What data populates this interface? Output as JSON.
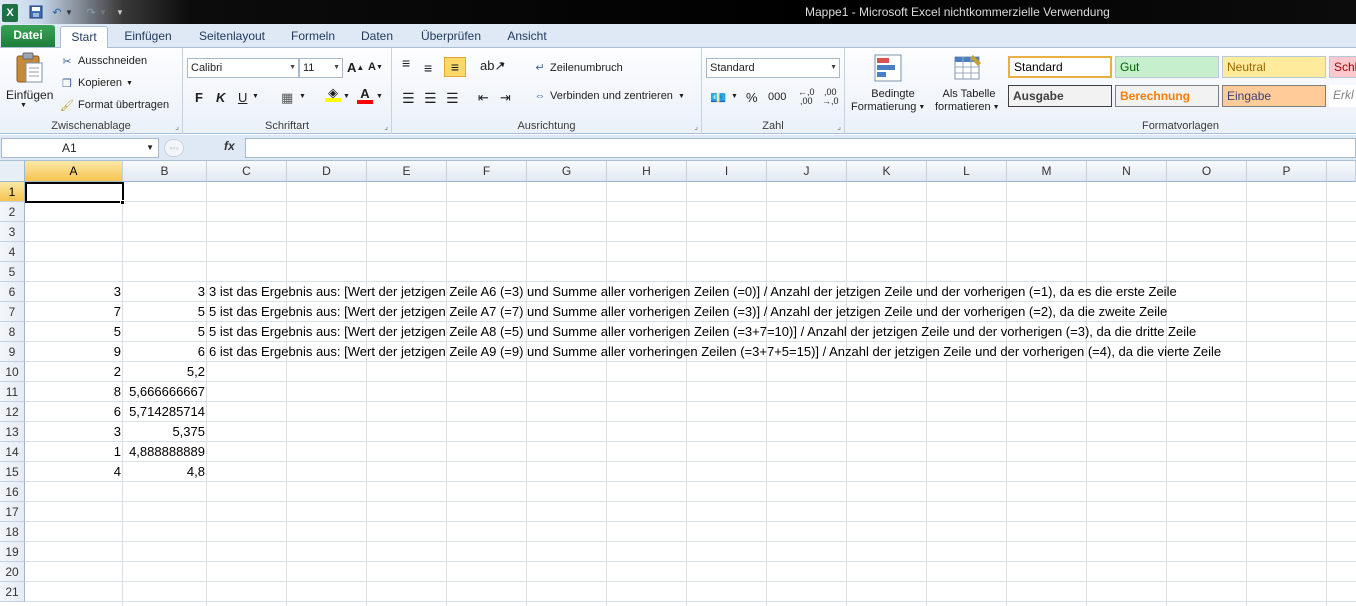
{
  "window": {
    "title": "Mappe1  -  Microsoft Excel nichtkommerzielle Verwendung",
    "app_icon": "excel-icon"
  },
  "tabs": {
    "file": "Datei",
    "start": "Start",
    "insert": "Einfügen",
    "layout": "Seitenlayout",
    "formulas": "Formeln",
    "data": "Daten",
    "review": "Überprüfen",
    "view": "Ansicht"
  },
  "ribbon": {
    "clipboard": {
      "label": "Zwischenablage",
      "paste": "Einfügen",
      "cut": "Ausschneiden",
      "copy": "Kopieren",
      "format_painter": "Format übertragen"
    },
    "font": {
      "label": "Schriftart",
      "name": "Calibri",
      "size": "11",
      "bold": "F",
      "italic": "K",
      "underline": "U"
    },
    "alignment": {
      "label": "Ausrichtung",
      "wrap": "Zeilenumbruch",
      "merge": "Verbinden und zentrieren"
    },
    "number": {
      "label": "Zahl",
      "format": "Standard",
      "percent": "%",
      "thousands": "000"
    },
    "styles": {
      "label": "Formatvorlagen",
      "conditional_1": "Bedingte",
      "conditional_2": "Formatierung",
      "table_1": "Als Tabelle",
      "table_2": "formatieren",
      "cells": [
        {
          "text": "Standard",
          "bg": "#ffffff",
          "color": "#000000"
        },
        {
          "text": "Gut",
          "bg": "#c6efce",
          "color": "#006100"
        },
        {
          "text": "Neutral",
          "bg": "#ffeb9c",
          "color": "#9c6500"
        },
        {
          "text": "Schl",
          "bg": "#ffc7ce",
          "color": "#9c0006"
        },
        {
          "text": "Ausgabe",
          "bg": "#f2f2f2",
          "color": "#3f3f3f"
        },
        {
          "text": "Berechnung",
          "bg": "#f2f2f2",
          "color": "#fa7d00"
        },
        {
          "text": "Eingabe",
          "bg": "#ffcc99",
          "color": "#3f3f76"
        },
        {
          "text": "Erkl",
          "bg": "#ffffff",
          "color": "#7f7f7f"
        }
      ]
    }
  },
  "formula_bar": {
    "name_box": "A1",
    "fx": "fx",
    "formula": ""
  },
  "sheet": {
    "columns": [
      "A",
      "B",
      "C",
      "D",
      "E",
      "F",
      "G",
      "H",
      "I",
      "J",
      "K",
      "L",
      "M",
      "N",
      "O",
      "P"
    ],
    "rows": [
      "1",
      "2",
      "3",
      "4",
      "5",
      "6",
      "7",
      "8",
      "9",
      "10",
      "11",
      "12",
      "13",
      "14",
      "15",
      "16",
      "17",
      "18",
      "19",
      "20",
      "21"
    ],
    "active_cell": "A1",
    "data_rows": [
      {
        "row": 6,
        "a": "3",
        "b": "3",
        "c": "3 ist das Ergebnis aus: [Wert der jetzigen Zeile A6 (=3) und Summe aller vorherigen Zeilen (=0)] / Anzahl der jetzigen Zeile und der vorherigen (=1), da es die erste Zeile"
      },
      {
        "row": 7,
        "a": "7",
        "b": "5",
        "c": "5 ist das Ergebnis aus: [Wert der jetzigen Zeile A7 (=7) und Summe aller vorherigen Zeilen (=3)] / Anzahl der jetzigen Zeile und der vorherigen (=2), da die zweite Zeile"
      },
      {
        "row": 8,
        "a": "5",
        "b": "5",
        "c": "5 ist das Ergebnis aus: [Wert der jetzigen Zeile A8 (=5) und Summe aller vorherigen Zeilen (=3+7=10)] / Anzahl der jetzigen Zeile und der vorherigen (=3), da die dritte Zeile"
      },
      {
        "row": 9,
        "a": "9",
        "b": "6",
        "c": "6 ist das Ergebnis aus: [Wert der jetzigen Zeile A9 (=9) und Summe aller vorheringen Zeilen (=3+7+5=15)] / Anzahl der jetzigen Zeile und der vorherigen (=4), da die vierte Zeile"
      },
      {
        "row": 10,
        "a": "2",
        "b": "5,2",
        "c": ""
      },
      {
        "row": 11,
        "a": "8",
        "b": "5,666666667",
        "c": ""
      },
      {
        "row": 12,
        "a": "6",
        "b": "5,714285714",
        "c": ""
      },
      {
        "row": 13,
        "a": "3",
        "b": "5,375",
        "c": ""
      },
      {
        "row": 14,
        "a": "1",
        "b": "4,888888889",
        "c": ""
      },
      {
        "row": 15,
        "a": "4",
        "b": "4,8",
        "c": ""
      }
    ]
  }
}
